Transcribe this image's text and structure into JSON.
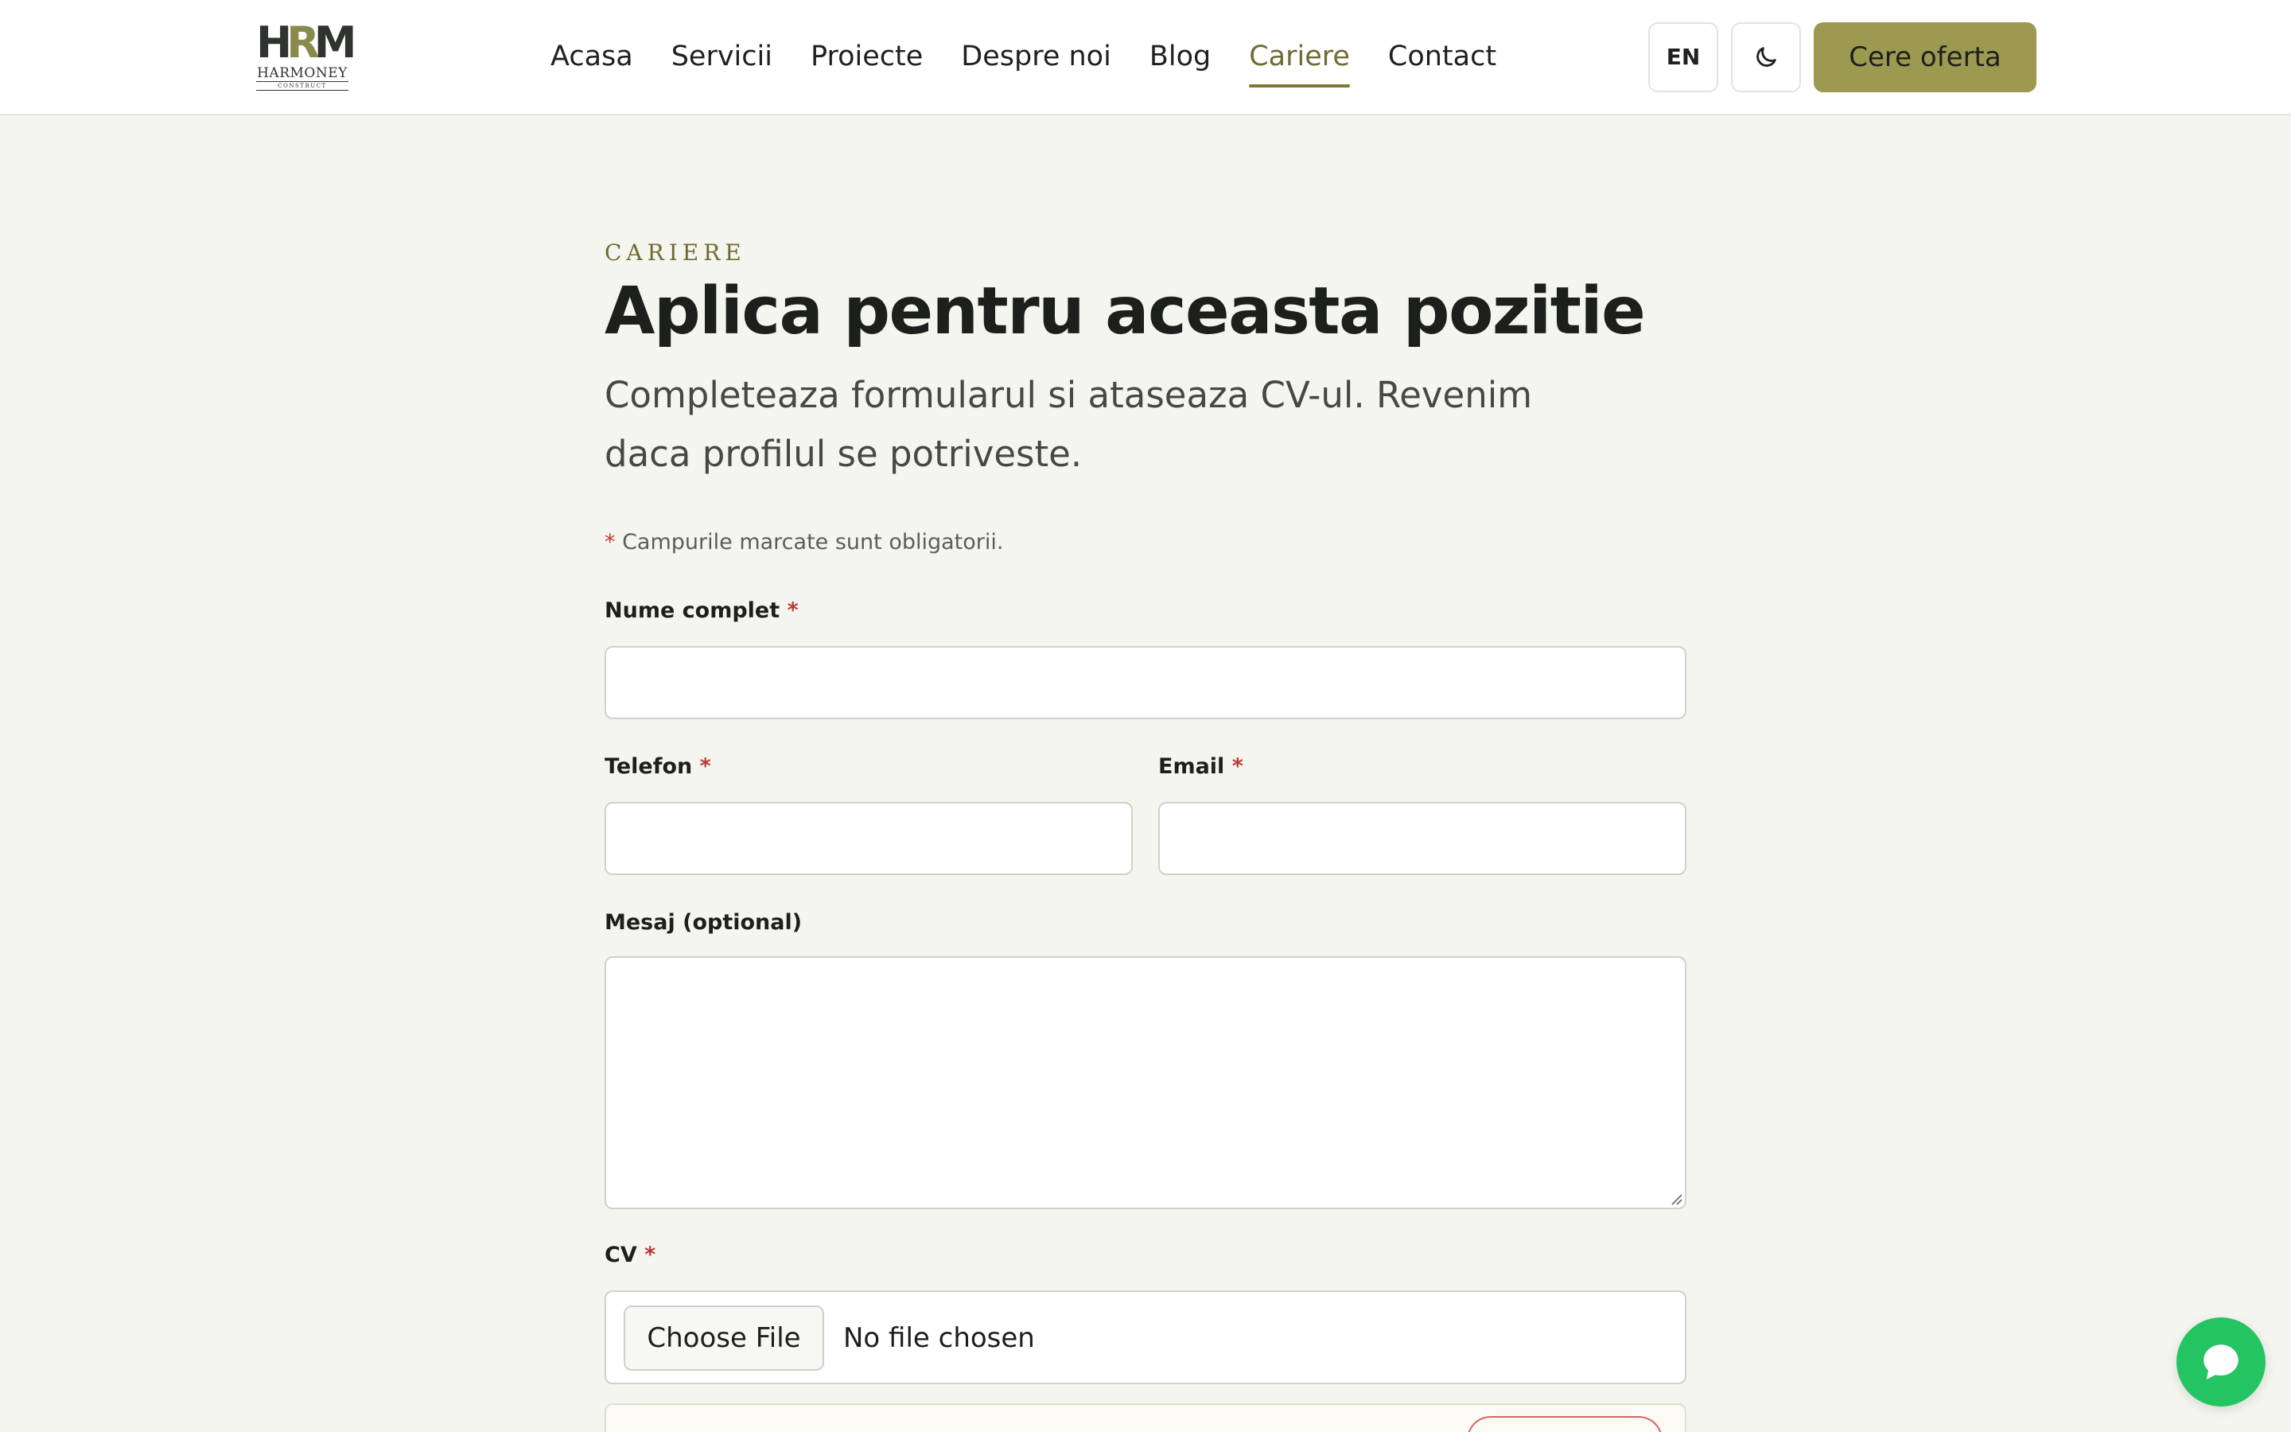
{
  "header": {
    "logo": {
      "mark_left": "H",
      "mark_mid": "R",
      "mark_right": "M",
      "name": "HARMONEY",
      "sub": "CONSTRUCT"
    },
    "nav": [
      {
        "label": "Acasa",
        "active": false
      },
      {
        "label": "Servicii",
        "active": false
      },
      {
        "label": "Proiecte",
        "active": false
      },
      {
        "label": "Despre noi",
        "active": false
      },
      {
        "label": "Blog",
        "active": false
      },
      {
        "label": "Cariere",
        "active": true
      },
      {
        "label": "Contact",
        "active": false
      }
    ],
    "lang_label": "EN",
    "theme_icon": "moon-icon",
    "cta_label": "Cere oferta"
  },
  "page": {
    "eyebrow": "CARIERE",
    "title": "Aplica pentru aceasta pozitie",
    "lead": "Completeaza formularul si ataseaza CV-ul. Revenim daca profilul se potriveste.",
    "required_note_star": "*",
    "required_note": " Campurile marcate sunt obligatorii."
  },
  "form": {
    "name_label": "Nume complet",
    "name_value": "",
    "phone_label": "Telefon",
    "phone_value": "",
    "email_label": "Email",
    "email_value": "",
    "message_label": "Mesaj (optional)",
    "message_value": "",
    "cv_label": "CV",
    "required_marker": "*",
    "file_button": "Choose File",
    "file_status": "No file chosen"
  },
  "colors": {
    "accent": "#9c9a50",
    "accent_text": "#6f6b33",
    "required": "#b73a36",
    "chat": "#25c462",
    "background": "#f5f5f0"
  },
  "chat": {
    "icon": "chat-bubble-icon"
  }
}
